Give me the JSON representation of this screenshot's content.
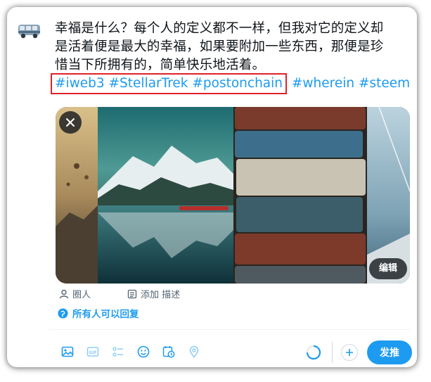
{
  "tweet": {
    "text_line1": "幸福是什么？每个人的定义都不一样，但我对它的定义却",
    "text_line2": "是活着便是最大的幸福，如果要附加一些东西，那便是珍",
    "text_line3": "惜当下所拥有的，简单快乐地活着。",
    "highlighted_tags": "#iweb3 #StellarTrek #postonchain",
    "other_tags": " #wherein #steem"
  },
  "media": {
    "close_icon": "close-icon",
    "edit_label": "编辑"
  },
  "meta": {
    "people_label": "圈人",
    "description_label": "添加 描述"
  },
  "reply": {
    "label": "所有人可以回复"
  },
  "toolbar": {
    "icons": [
      "image-icon",
      "gif-icon",
      "poll-icon",
      "emoji-icon",
      "schedule-icon",
      "location-icon"
    ],
    "gif_text": "GIF",
    "post_label": "发推"
  },
  "colors": {
    "accent": "#1d9bf0",
    "highlight_box": "#e0222a",
    "text": "#0f1419",
    "muted": "#536471"
  }
}
